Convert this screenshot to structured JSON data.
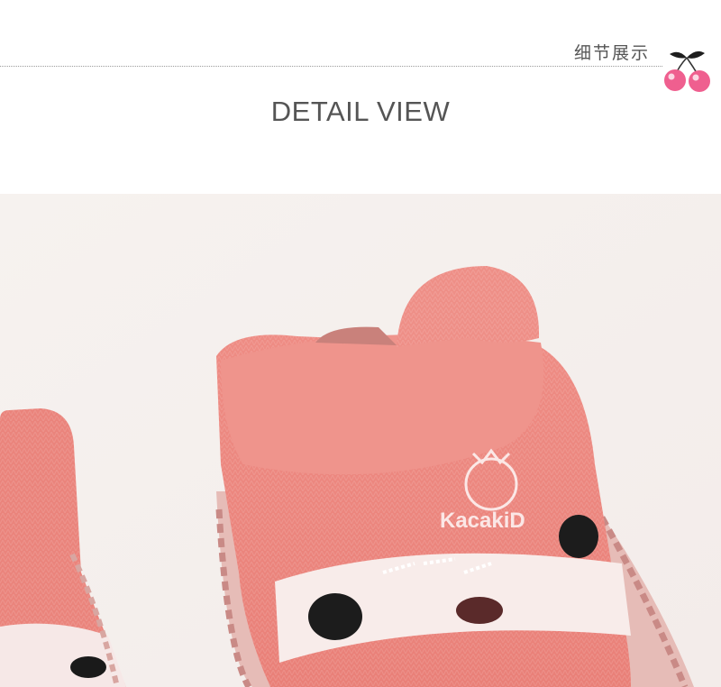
{
  "header": {
    "section_label_cn": "细节展示",
    "title": "DETAIL VIEW",
    "decoration_icon": "cherry-icon"
  },
  "photo": {
    "brand_text": "KacakiD",
    "colors": {
      "sock_pink": "#ef8f86",
      "sock_dark_pink": "#e47b73",
      "background": "#f6f2f0",
      "stitch": "#c98a86"
    }
  }
}
